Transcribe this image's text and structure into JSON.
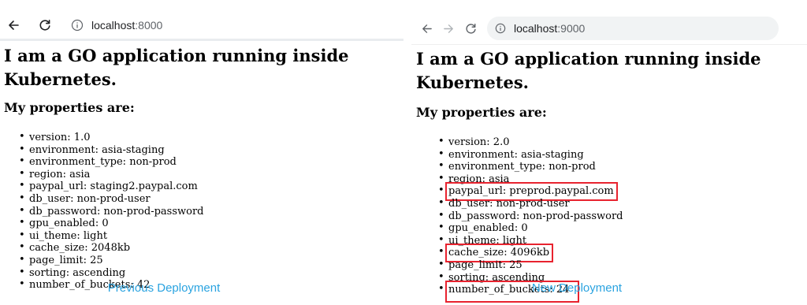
{
  "left": {
    "url_host": "localhost",
    "url_port": ":8000",
    "heading": "I am a GO application running inside Kubernetes.",
    "subheading": "My properties are:",
    "properties": [
      "version: 1.0",
      "environment: asia-staging",
      "environment_type: non-prod",
      "region: asia",
      "paypal_url: staging2.paypal.com",
      "db_user: non-prod-user",
      "db_password: non-prod-password",
      "gpu_enabled: 0",
      "ui_theme: light",
      "cache_size: 2048kb",
      "page_limit: 25",
      "sorting: ascending",
      "number_of_buckets: 42"
    ],
    "caption": "Previous Deployment"
  },
  "right": {
    "url_host": "localhost",
    "url_port": ":9000",
    "heading": "I am a GO application running inside Kubernetes.",
    "subheading": "My properties are:",
    "properties": [
      "version: 2.0",
      "environment: asia-staging",
      "environment_type: non-prod",
      "region: asia",
      "paypal_url: preprod.paypal.com",
      "db_user: non-prod-user",
      "db_password: non-prod-password",
      "gpu_enabled: 0",
      "ui_theme: light",
      "cache_size: 4096kb",
      "page_limit: 25",
      "sorting: ascending",
      "number_of_buckets: 24"
    ],
    "highlighted_properties": [
      "paypal_url",
      "cache_size",
      "number_of_buckets"
    ],
    "caption": "New Deployment"
  },
  "colors": {
    "highlight_box": "#e8232f",
    "caption": "#2aa3e0",
    "icon": "#5f6368"
  },
  "icons": {
    "back": "arrow-left-icon",
    "forward": "arrow-right-icon",
    "reload": "reload-icon",
    "site_info": "info-icon"
  }
}
